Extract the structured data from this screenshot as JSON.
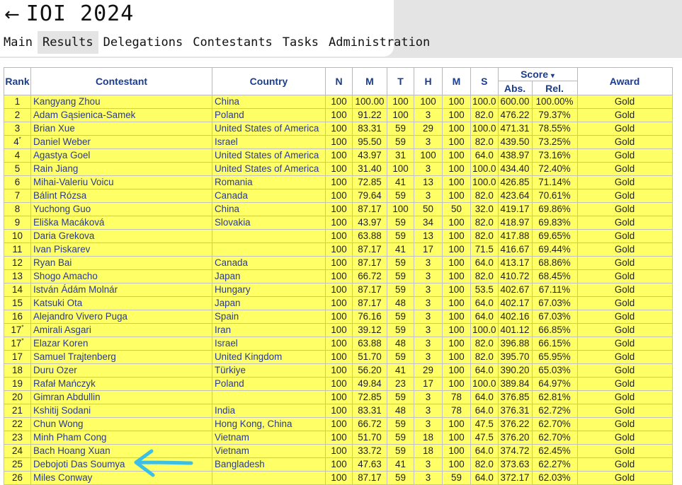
{
  "header": {
    "back": "←",
    "title": "IOI 2024"
  },
  "tabs": [
    {
      "label": "Main",
      "active": false
    },
    {
      "label": "Results",
      "active": true
    },
    {
      "label": "Delegations",
      "active": false
    },
    {
      "label": "Contestants",
      "active": false
    },
    {
      "label": "Tasks",
      "active": false
    },
    {
      "label": "Administration",
      "active": false
    }
  ],
  "table": {
    "headers": {
      "rank": "Rank",
      "contestant": "Contestant",
      "country": "Country",
      "n": "N",
      "m1": "M",
      "t": "T",
      "h": "H",
      "m2": "M",
      "s": "S",
      "score": "Score",
      "sort_indicator": "▾",
      "abs": "Abs.",
      "rel": "Rel.",
      "award": "Award"
    },
    "rows": [
      {
        "rank": "1",
        "star": "",
        "name": "Kangyang Zhou",
        "country": "China",
        "n": "100",
        "m1": "100.00",
        "t": "100",
        "h": "100",
        "m2": "100",
        "s": "100.0",
        "abs": "600.00",
        "rel": "100.00%",
        "award": "Gold"
      },
      {
        "rank": "2",
        "star": "",
        "name": "Adam Gąsienica-Samek",
        "country": "Poland",
        "n": "100",
        "m1": "91.22",
        "t": "100",
        "h": "3",
        "m2": "100",
        "s": "82.0",
        "abs": "476.22",
        "rel": "79.37%",
        "award": "Gold"
      },
      {
        "rank": "3",
        "star": "",
        "name": "Brian Xue",
        "country": "United States of America",
        "n": "100",
        "m1": "83.31",
        "t": "59",
        "h": "29",
        "m2": "100",
        "s": "100.0",
        "abs": "471.31",
        "rel": "78.55%",
        "award": "Gold"
      },
      {
        "rank": "4",
        "star": "*",
        "name": "Daniel Weber",
        "country": "Israel",
        "n": "100",
        "m1": "95.50",
        "t": "59",
        "h": "3",
        "m2": "100",
        "s": "82.0",
        "abs": "439.50",
        "rel": "73.25%",
        "award": "Gold"
      },
      {
        "rank": "4",
        "star": "",
        "name": "Agastya Goel",
        "country": "United States of America",
        "n": "100",
        "m1": "43.97",
        "t": "31",
        "h": "100",
        "m2": "100",
        "s": "64.0",
        "abs": "438.97",
        "rel": "73.16%",
        "award": "Gold"
      },
      {
        "rank": "5",
        "star": "",
        "name": "Rain Jiang",
        "country": "United States of America",
        "n": "100",
        "m1": "31.40",
        "t": "100",
        "h": "3",
        "m2": "100",
        "s": "100.0",
        "abs": "434.40",
        "rel": "72.40%",
        "award": "Gold"
      },
      {
        "rank": "6",
        "star": "",
        "name": "Mihai-Valeriu Voicu",
        "country": "Romania",
        "n": "100",
        "m1": "72.85",
        "t": "41",
        "h": "13",
        "m2": "100",
        "s": "100.0",
        "abs": "426.85",
        "rel": "71.14%",
        "award": "Gold"
      },
      {
        "rank": "7",
        "star": "",
        "name": "Bálint Rózsa",
        "country": "Canada",
        "n": "100",
        "m1": "79.64",
        "t": "59",
        "h": "3",
        "m2": "100",
        "s": "82.0",
        "abs": "423.64",
        "rel": "70.61%",
        "award": "Gold"
      },
      {
        "rank": "8",
        "star": "",
        "name": "Yuchong Guo",
        "country": "China",
        "n": "100",
        "m1": "87.17",
        "t": "100",
        "h": "50",
        "m2": "50",
        "s": "32.0",
        "abs": "419.17",
        "rel": "69.86%",
        "award": "Gold"
      },
      {
        "rank": "9",
        "star": "",
        "name": "Eliška Macáková",
        "country": "Slovakia",
        "n": "100",
        "m1": "43.97",
        "t": "59",
        "h": "34",
        "m2": "100",
        "s": "82.0",
        "abs": "418.97",
        "rel": "69.83%",
        "award": "Gold"
      },
      {
        "rank": "10",
        "star": "",
        "name": "Daria Grekova",
        "country": "",
        "n": "100",
        "m1": "63.88",
        "t": "59",
        "h": "13",
        "m2": "100",
        "s": "82.0",
        "abs": "417.88",
        "rel": "69.65%",
        "award": "Gold"
      },
      {
        "rank": "11",
        "star": "",
        "name": "Ivan Piskarev",
        "country": "",
        "n": "100",
        "m1": "87.17",
        "t": "41",
        "h": "17",
        "m2": "100",
        "s": "71.5",
        "abs": "416.67",
        "rel": "69.44%",
        "award": "Gold"
      },
      {
        "rank": "12",
        "star": "",
        "name": "Ryan Bai",
        "country": "Canada",
        "n": "100",
        "m1": "87.17",
        "t": "59",
        "h": "3",
        "m2": "100",
        "s": "64.0",
        "abs": "413.17",
        "rel": "68.86%",
        "award": "Gold"
      },
      {
        "rank": "13",
        "star": "",
        "name": "Shogo Amacho",
        "country": "Japan",
        "n": "100",
        "m1": "66.72",
        "t": "59",
        "h": "3",
        "m2": "100",
        "s": "82.0",
        "abs": "410.72",
        "rel": "68.45%",
        "award": "Gold"
      },
      {
        "rank": "14",
        "star": "",
        "name": "István Ádám Molnár",
        "country": "Hungary",
        "n": "100",
        "m1": "87.17",
        "t": "59",
        "h": "3",
        "m2": "100",
        "s": "53.5",
        "abs": "402.67",
        "rel": "67.11%",
        "award": "Gold"
      },
      {
        "rank": "15",
        "star": "",
        "name": "Katsuki Ota",
        "country": "Japan",
        "n": "100",
        "m1": "87.17",
        "t": "48",
        "h": "3",
        "m2": "100",
        "s": "64.0",
        "abs": "402.17",
        "rel": "67.03%",
        "award": "Gold"
      },
      {
        "rank": "16",
        "star": "",
        "name": "Alejandro Vivero Puga",
        "country": "Spain",
        "n": "100",
        "m1": "76.16",
        "t": "59",
        "h": "3",
        "m2": "100",
        "s": "64.0",
        "abs": "402.16",
        "rel": "67.03%",
        "award": "Gold"
      },
      {
        "rank": "17",
        "star": "*",
        "name": "Amirali Asgari",
        "country": "Iran",
        "n": "100",
        "m1": "39.12",
        "t": "59",
        "h": "3",
        "m2": "100",
        "s": "100.0",
        "abs": "401.12",
        "rel": "66.85%",
        "award": "Gold"
      },
      {
        "rank": "17",
        "star": "*",
        "name": "Elazar Koren",
        "country": "Israel",
        "n": "100",
        "m1": "63.88",
        "t": "48",
        "h": "3",
        "m2": "100",
        "s": "82.0",
        "abs": "396.88",
        "rel": "66.15%",
        "award": "Gold"
      },
      {
        "rank": "17",
        "star": "",
        "name": "Samuel Trajtenberg",
        "country": "United Kingdom",
        "n": "100",
        "m1": "51.70",
        "t": "59",
        "h": "3",
        "m2": "100",
        "s": "82.0",
        "abs": "395.70",
        "rel": "65.95%",
        "award": "Gold"
      },
      {
        "rank": "18",
        "star": "",
        "name": "Duru Ozer",
        "country": "Türkiye",
        "n": "100",
        "m1": "56.20",
        "t": "41",
        "h": "29",
        "m2": "100",
        "s": "64.0",
        "abs": "390.20",
        "rel": "65.03%",
        "award": "Gold"
      },
      {
        "rank": "19",
        "star": "",
        "name": "Rafał Mańczyk",
        "country": "Poland",
        "n": "100",
        "m1": "49.84",
        "t": "23",
        "h": "17",
        "m2": "100",
        "s": "100.0",
        "abs": "389.84",
        "rel": "64.97%",
        "award": "Gold"
      },
      {
        "rank": "20",
        "star": "",
        "name": "Gimran Abdullin",
        "country": "",
        "n": "100",
        "m1": "72.85",
        "t": "59",
        "h": "3",
        "m2": "78",
        "s": "64.0",
        "abs": "376.85",
        "rel": "62.81%",
        "award": "Gold"
      },
      {
        "rank": "21",
        "star": "",
        "name": "Kshitij Sodani",
        "country": "India",
        "n": "100",
        "m1": "83.31",
        "t": "48",
        "h": "3",
        "m2": "78",
        "s": "64.0",
        "abs": "376.31",
        "rel": "62.72%",
        "award": "Gold"
      },
      {
        "rank": "22",
        "star": "",
        "name": "Chun Wong",
        "country": "Hong Kong, China",
        "n": "100",
        "m1": "66.72",
        "t": "59",
        "h": "3",
        "m2": "100",
        "s": "47.5",
        "abs": "376.22",
        "rel": "62.70%",
        "award": "Gold"
      },
      {
        "rank": "23",
        "star": "",
        "name": "Minh Pham Cong",
        "country": "Vietnam",
        "n": "100",
        "m1": "51.70",
        "t": "59",
        "h": "18",
        "m2": "100",
        "s": "47.5",
        "abs": "376.20",
        "rel": "62.70%",
        "award": "Gold"
      },
      {
        "rank": "24",
        "star": "",
        "name": "Bach Hoang Xuan",
        "country": "Vietnam",
        "n": "100",
        "m1": "33.72",
        "t": "59",
        "h": "18",
        "m2": "100",
        "s": "64.0",
        "abs": "374.72",
        "rel": "62.45%",
        "award": "Gold"
      },
      {
        "rank": "25",
        "star": "",
        "name": "Debojoti Das Soumya",
        "country": "Bangladesh",
        "n": "100",
        "m1": "47.63",
        "t": "41",
        "h": "3",
        "m2": "100",
        "s": "82.0",
        "abs": "373.63",
        "rel": "62.27%",
        "award": "Gold"
      },
      {
        "rank": "26",
        "star": "",
        "name": "Miles Conway",
        "country": "",
        "n": "100",
        "m1": "87.17",
        "t": "59",
        "h": "3",
        "m2": "59",
        "s": "64.0",
        "abs": "372.17",
        "rel": "62.03%",
        "award": "Gold"
      }
    ]
  },
  "colors": {
    "row_bg": "#ffff66",
    "header_text": "#1a3d8f",
    "arrow": "#3bbfe6",
    "tab_active_bg": "#e4e4e4"
  }
}
